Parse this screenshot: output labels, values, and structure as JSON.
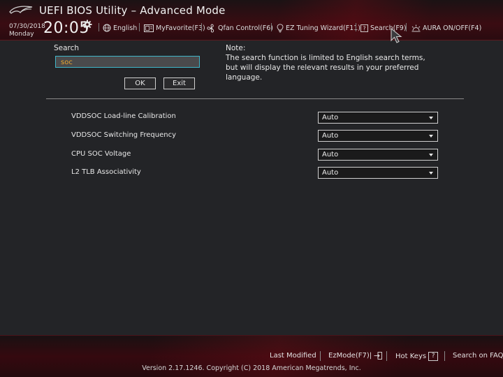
{
  "header": {
    "title": "UEFI BIOS Utility – Advanced Mode",
    "date": "07/30/2018",
    "day": "Monday",
    "time": "20:05",
    "menu": [
      {
        "label": "English",
        "icon": "globe-icon"
      },
      {
        "label": "MyFavorite(F3)",
        "icon": "favorite-icon"
      },
      {
        "label": "Qfan Control(F6)",
        "icon": "fan-icon"
      },
      {
        "label": "EZ Tuning Wizard(F11)",
        "icon": "lightbulb-icon"
      },
      {
        "label": "Search(F9)",
        "icon": "search-help-icon"
      },
      {
        "label": "AURA ON/OFF(F4)",
        "icon": "aura-icon"
      }
    ]
  },
  "search": {
    "label": "Search",
    "value": "soc",
    "ok_label": "OK",
    "exit_label": "Exit",
    "note_title": "Note:",
    "note_text": "The search function is limited to English search terms, but will display the relevant results in your preferred language."
  },
  "results": [
    {
      "label": "VDDSOC Load-line Calibration",
      "value": "Auto"
    },
    {
      "label": "VDDSOC Switching Frequency",
      "value": "Auto"
    },
    {
      "label": "CPU SOC Voltage",
      "value": "Auto"
    },
    {
      "label": "L2 TLB Associativity",
      "value": "Auto"
    }
  ],
  "footer": {
    "last_modified": "Last Modified",
    "ezmode": "EzMode(F7)|",
    "hot_keys": "Hot Keys",
    "hot_keys_key": "?",
    "search_faq": "Search on FAQ",
    "copyright": "Version 2.17.1246. Copyright (C) 2018 American Megatrends, Inc."
  },
  "colors": {
    "accent_red": "#3a0c12",
    "input_border": "#3fb6c9",
    "search_text": "#e7a52e"
  }
}
